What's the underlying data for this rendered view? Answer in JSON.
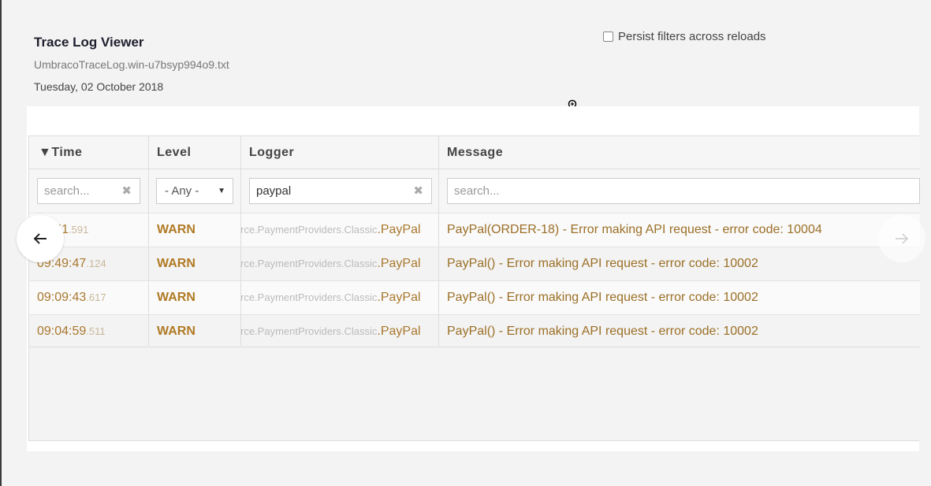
{
  "header": {
    "title": "Trace Log Viewer",
    "file": "UmbracoTraceLog.win-u7bsyp994o9.txt",
    "date": "Tuesday, 02 October 2018"
  },
  "persist_filters": {
    "label": "Persist filters across reloads",
    "checked": false
  },
  "table": {
    "columns": [
      "▼Time",
      "Level",
      "Logger",
      "Message"
    ],
    "filters": {
      "time": {
        "value": "",
        "placeholder": "search..."
      },
      "level": {
        "selected": "- Any -"
      },
      "logger": {
        "value": "paypal",
        "placeholder": ""
      },
      "message": {
        "value": "",
        "placeholder": "search..."
      }
    },
    "rows": [
      {
        "time_main": "10:51",
        "time_ms": ".591",
        "level": "WARN",
        "logger_prefix": "rce.PaymentProviders.Classic",
        "logger_main": ".PayPal",
        "message": "PayPal(ORDER-18) - Error making API request - error code: 10004"
      },
      {
        "time_main": "09:49:47",
        "time_ms": ".124",
        "level": "WARN",
        "logger_prefix": "rce.PaymentProviders.Classic",
        "logger_main": ".PayPal",
        "message": "PayPal() - Error making API request - error code: 10002"
      },
      {
        "time_main": "09:09:43",
        "time_ms": ".617",
        "level": "WARN",
        "logger_prefix": "rce.PaymentProviders.Classic",
        "logger_main": ".PayPal",
        "message": "PayPal() - Error making API request - error code: 10002"
      },
      {
        "time_main": "09:04:59",
        "time_ms": ".511",
        "level": "WARN",
        "logger_prefix": "rce.PaymentProviders.Classic",
        "logger_main": ".PayPal",
        "message": "PayPal() - Error making API request - error code: 10002"
      }
    ]
  },
  "nav": {
    "prev_icon": "arrow-left-icon",
    "next_icon": "arrow-right-icon"
  }
}
